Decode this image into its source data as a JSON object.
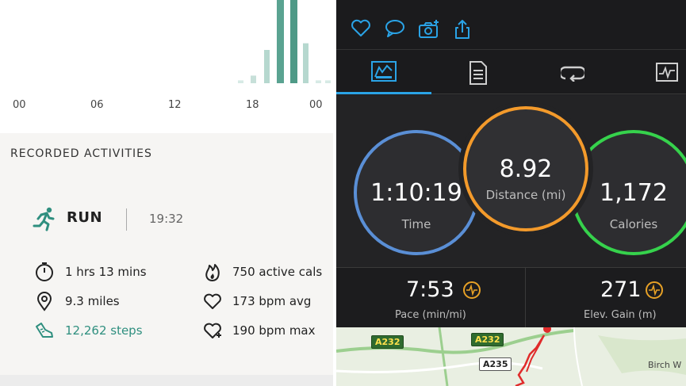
{
  "histogram": {
    "x_labels": [
      "00",
      "06",
      "12",
      "18",
      "00"
    ],
    "bars": [
      0.03,
      0.08,
      0.35,
      1.0,
      1.0,
      0.42,
      0.03,
      0.03
    ]
  },
  "activities": {
    "title": "RECORDED ACTIVITIES",
    "type": "RUN",
    "time": "19:32",
    "duration": "1 hrs 13 mins",
    "distance": "9.3  miles",
    "steps": "12,262 steps",
    "active_cals": "750 active cals",
    "bpm_avg": "173 bpm avg",
    "bpm_max": "190 bpm max",
    "colors": {
      "accent": "#2f8f7f"
    }
  },
  "garmin": {
    "toolbar_icons": [
      "heart-icon",
      "comment-icon",
      "camera-add-icon",
      "share-icon"
    ],
    "tabs": [
      "summary-icon",
      "details-icon",
      "laps-icon",
      "chart-icon"
    ],
    "time": {
      "value": "1:10:19",
      "label": "Time"
    },
    "distance": {
      "value": "8.92",
      "label": "Distance (mi)"
    },
    "calories": {
      "value": "1,172",
      "label": "Calories"
    },
    "pace": {
      "value": "7:53",
      "label": "Pace (min/mi)"
    },
    "elev": {
      "value": "271",
      "label": "Elev. Gain (m)"
    },
    "map": {
      "roads": [
        "A232",
        "A232",
        "A235"
      ],
      "place": "Birch W"
    },
    "colors": {
      "time_ring": "#5a8fd6",
      "distance_ring": "#f39a2b",
      "calories_ring": "#36d24c",
      "accent": "#2aa3e6"
    }
  }
}
